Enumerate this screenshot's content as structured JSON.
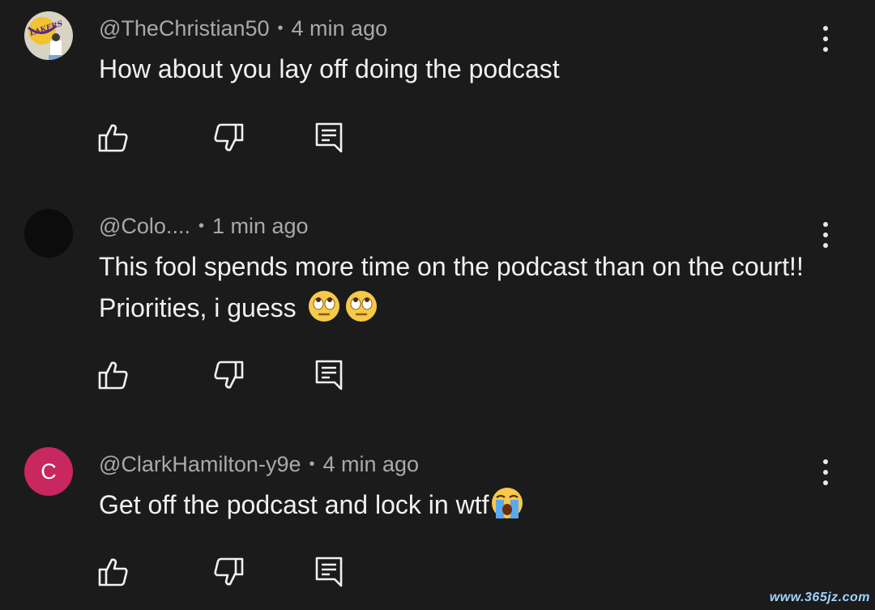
{
  "comments": [
    {
      "handle": "@TheChristian50",
      "separator": "•",
      "time": "4 min ago",
      "text": "How about you lay off doing the podcast",
      "avatar_type": "image",
      "avatar_text": "LAKERS",
      "emojis": []
    },
    {
      "handle": "@Colo....",
      "separator": "•",
      "time": "1 min ago",
      "text": "This fool spends more time on the podcast than on the court!! Priorities, i guess",
      "avatar_type": "dark",
      "emojis": [
        "face-with-rolling-eyes",
        "face-with-rolling-eyes"
      ]
    },
    {
      "handle": "@ClarkHamilton-y9e",
      "separator": "•",
      "time": "4 min ago",
      "text": "Get off the podcast and lock in wtf",
      "avatar_type": "letter",
      "avatar_letter": "C",
      "emojis": [
        "loudly-crying-face"
      ]
    }
  ],
  "icons": {
    "like": "thumbs-up-outline",
    "dislike": "thumbs-down-outline",
    "reply": "reply-comment-outline",
    "more": "vertical-ellipsis"
  },
  "colors": {
    "background": "#1b1b1b",
    "primary_text": "#f1f1f1",
    "secondary_text": "#a9a9a9",
    "letter_avatar": "#c9275f"
  },
  "watermark": "www.365jz.com"
}
